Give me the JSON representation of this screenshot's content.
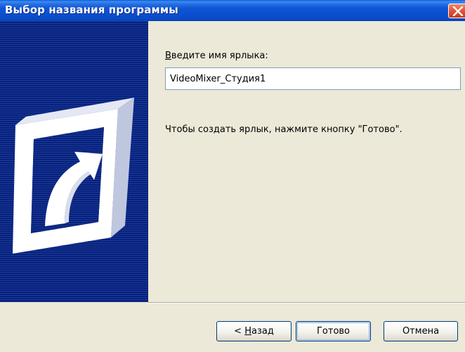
{
  "window": {
    "title": "Выбор названия программы"
  },
  "form": {
    "label_prefix": "",
    "label_accel": "В",
    "label_rest": "ведите имя ярлыка:",
    "input_value": "VideoMixer_Студия1",
    "hint": "Чтобы создать ярлык, нажмите кнопку \"Готово\"."
  },
  "buttons": {
    "back_prefix": "< ",
    "back_accel": "Н",
    "back_rest": "азад",
    "finish": "Готово",
    "cancel": "Отмена"
  },
  "icons": {
    "close": "close-icon",
    "shortcut": "shortcut-arrow-icon"
  },
  "colors": {
    "titlebar": "#0A4FCE",
    "panel": "#0A2A80",
    "close_button": "#E3583A",
    "dialog_bg": "#ECE9D8"
  }
}
